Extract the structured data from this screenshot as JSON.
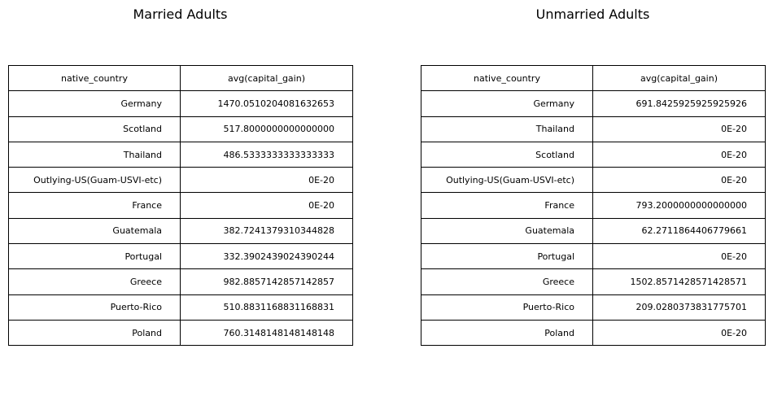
{
  "chart_data": [
    {
      "type": "table",
      "title": "Married Adults",
      "columns": [
        "native_country",
        "avg(capital_gain)"
      ],
      "rows": [
        [
          "Germany",
          "1470.0510204081632653"
        ],
        [
          "Scotland",
          "517.8000000000000000"
        ],
        [
          "Thailand",
          "486.5333333333333333"
        ],
        [
          "Outlying-US(Guam-USVI-etc)",
          "0E-20"
        ],
        [
          "France",
          "0E-20"
        ],
        [
          "Guatemala",
          "382.7241379310344828"
        ],
        [
          "Portugal",
          "332.3902439024390244"
        ],
        [
          "Greece",
          "982.8857142857142857"
        ],
        [
          "Puerto-Rico",
          "510.8831168831168831"
        ],
        [
          "Poland",
          "760.3148148148148148"
        ]
      ]
    },
    {
      "type": "table",
      "title": "Unmarried Adults",
      "columns": [
        "native_country",
        "avg(capital_gain)"
      ],
      "rows": [
        [
          "Germany",
          "691.8425925925925926"
        ],
        [
          "Thailand",
          "0E-20"
        ],
        [
          "Scotland",
          "0E-20"
        ],
        [
          "Outlying-US(Guam-USVI-etc)",
          "0E-20"
        ],
        [
          "France",
          "793.2000000000000000"
        ],
        [
          "Guatemala",
          "62.2711864406779661"
        ],
        [
          "Portugal",
          "0E-20"
        ],
        [
          "Greece",
          "1502.8571428571428571"
        ],
        [
          "Puerto-Rico",
          "209.0280373831775701"
        ],
        [
          "Poland",
          "0E-20"
        ]
      ]
    }
  ]
}
